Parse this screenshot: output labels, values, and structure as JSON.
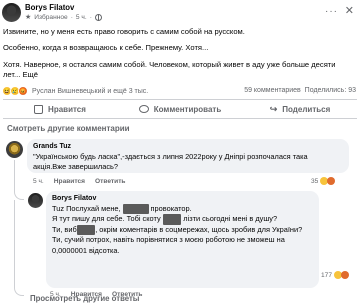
{
  "post": {
    "author": "Borys Filatov",
    "visibility": "Избранное",
    "time_ago": "5 ч.",
    "paragraphs": [
      "Извините, но у меня есть право говорить с самим собой на русском.",
      "Особенно, когда я возвращаюсь к себе. Прежнему. Хотя...",
      "Хотя. Наверное, я остался самим собой. Человеком, который живет в аду уже больше десяти",
      "лет... Ещё"
    ],
    "reactions_text": "Руслан Вишневецький и ещё 3 тыс.",
    "comments_count": "59 комментариев",
    "shares_count": "Поделились: 93"
  },
  "actions": {
    "like": "Нравится",
    "comment": "Комментировать",
    "share": "Поделиться"
  },
  "see_other_comments": "Смотреть другие комментарии",
  "comment1": {
    "author": "Grands Tuz",
    "lines": [
      "\"Українською будь ласка\",-здається з липня 2022року у Дніпрі розпочалася така",
      "акція.Вже завершилась?"
    ],
    "time": "5 ч.",
    "like": "Нравится",
    "reply": "Ответить",
    "reaction_count": "35"
  },
  "reply1": {
    "author": "Borys Filatov",
    "lines": [
      [
        "Tuz Послухай мене, ",
        "",
        " провокатор."
      ],
      [
        "Я тут пишу для себе. Тобі скоту ",
        "",
        " лізти сьогодні мені в душу?"
      ],
      [
        "Ти, виб",
        "",
        ", окрім коментарів в соцмережах, щось зробив для України?"
      ],
      [
        "Ти, сучий потрох, навіть порівнятися з моєю роботою не зможеш на",
        "",
        ""
      ],
      [
        "0,0000001 відсотка.",
        "",
        ""
      ]
    ],
    "time": "5 ч.",
    "like": "Нравится",
    "reply": "Ответить",
    "reaction_count": "177"
  },
  "see_other_replies": "Просмотреть другие ответы"
}
